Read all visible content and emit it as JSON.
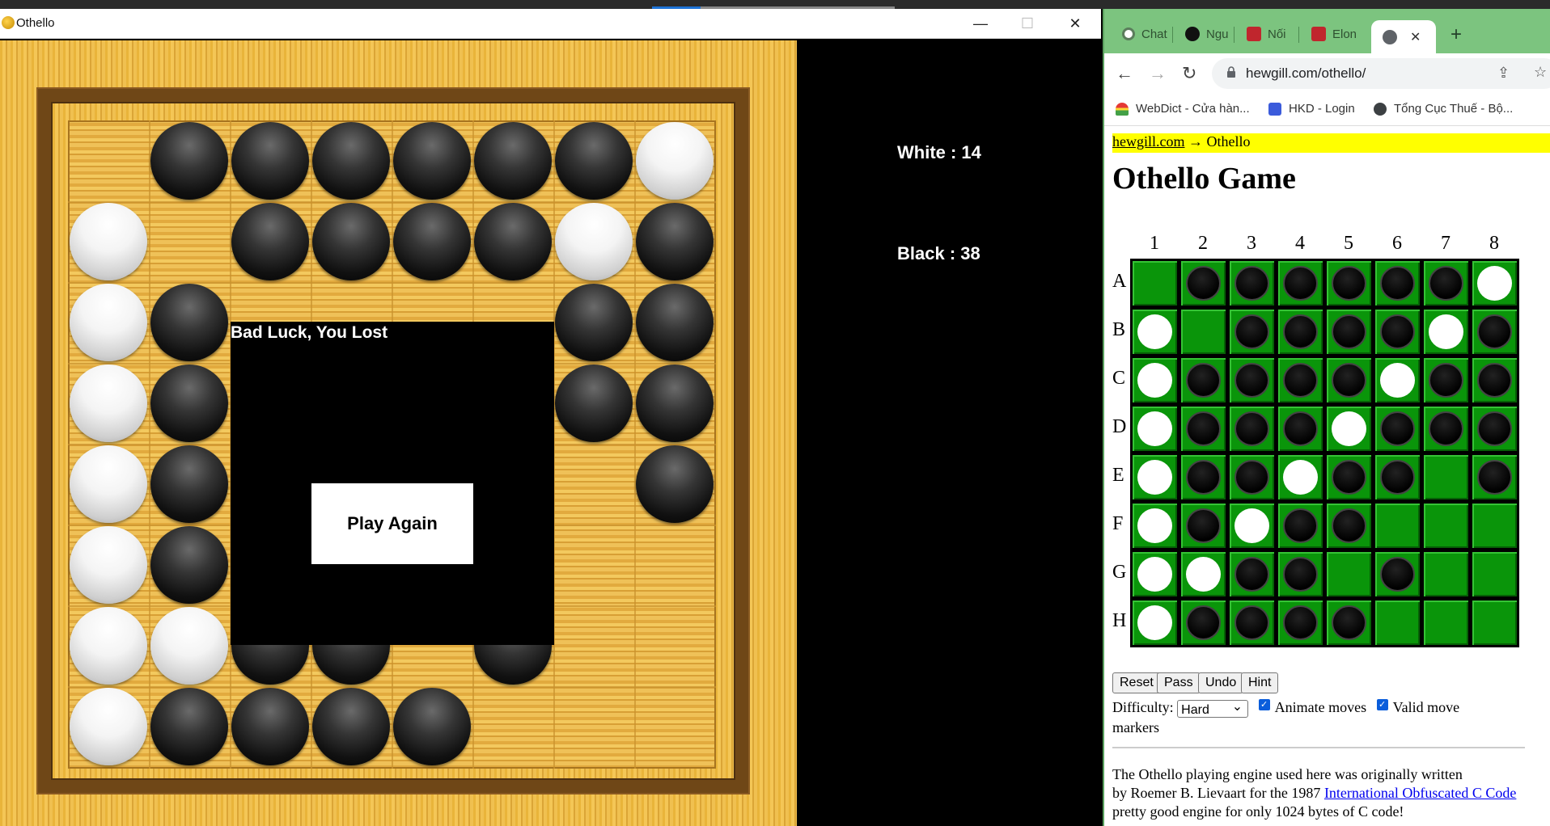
{
  "game_window": {
    "title": "Othello",
    "minimize": "—",
    "maximize": "☐",
    "close": "✕",
    "overlay_message": "Bad Luck, You Lost",
    "play_again": "Play Again",
    "score_white": "White : 14",
    "score_black": "Black : 38",
    "board": [
      "-BBBBBBW",
      "W-BBBBWB",
      "WB----BB",
      "WB----BB",
      "WB----.B",
      "WB------",
      "WWBB.B..",
      "WBBBB..."
    ]
  },
  "browser": {
    "tabs": [
      {
        "label": "Chat"
      },
      {
        "label": "Ngu"
      },
      {
        "label": "Nối"
      },
      {
        "label": "Elon"
      }
    ],
    "active_tab_close": "✕",
    "new_tab": "+",
    "url": "hewgill.com/othello/",
    "bookmarks": [
      {
        "label": "WebDict - Cửa hàn..."
      },
      {
        "label": "HKD - Login"
      },
      {
        "label": "Tổng Cục Thuế - Bộ..."
      }
    ]
  },
  "page": {
    "crumb_link": "hewgill.com",
    "crumb_rest": " → Othello",
    "heading": "Othello Game",
    "columns": [
      "1",
      "2",
      "3",
      "4",
      "5",
      "6",
      "7",
      "8"
    ],
    "rows": [
      "A",
      "B",
      "C",
      "D",
      "E",
      "F",
      "G",
      "H"
    ],
    "board": [
      ".BBBBBBW",
      "W.BBBBWB",
      "WBBBBWBB",
      "WBBBWBBB",
      "WBBWBB.B",
      "WBWBB...",
      "WWBB.B..",
      "WBBBB..."
    ],
    "buttons": {
      "reset": "Reset",
      "pass": "Pass",
      "undo": "Undo",
      "hint": "Hint"
    },
    "difficulty_label": "Difficulty:",
    "difficulty_value": "Hard",
    "animate_label": "Animate moves",
    "valid_label": "Valid move",
    "markers_label": "markers",
    "para_line1": "The Othello playing engine used here was originally written",
    "para_line2_a": "by Roemer B. Lievaart for the 1987 ",
    "para_line2_link": "International Obfuscated C Code",
    "para_line3": "pretty good engine for only 1024 bytes of C code!"
  }
}
